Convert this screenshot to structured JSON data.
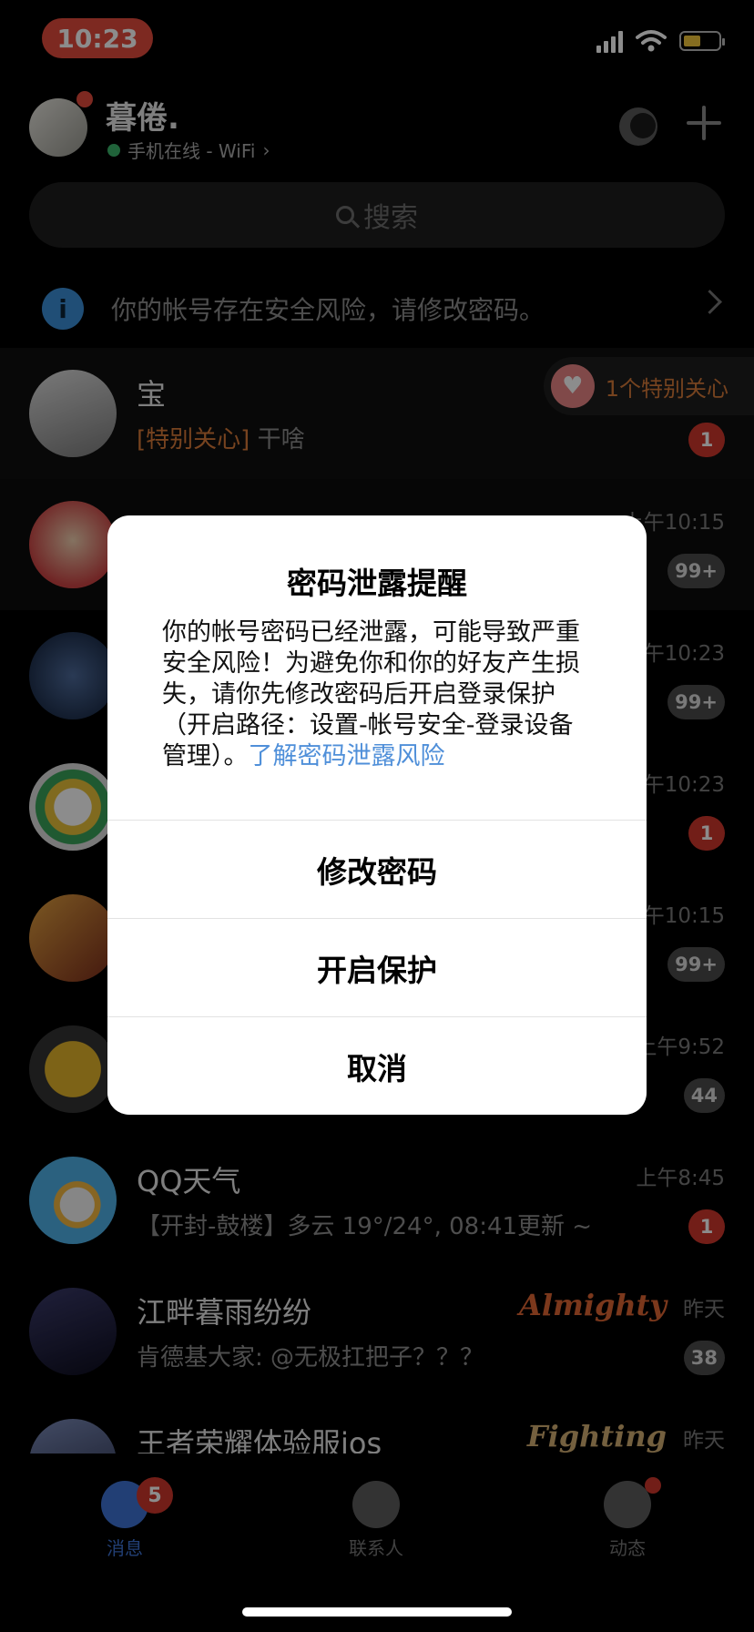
{
  "status_bar": {
    "time": "10:23"
  },
  "header": {
    "username": "暮倦.",
    "online_status": "手机在线 - WiFi",
    "online_chevron": "›"
  },
  "search": {
    "placeholder": "搜索"
  },
  "banner": {
    "icon_text": "i",
    "text": "你的帐号存在安全风险，请修改密码。"
  },
  "special_care_pill": {
    "label": "1个特别关心"
  },
  "chats": [
    {
      "name": "宝",
      "tag": "[特别关心]",
      "message": "干啥",
      "time": "",
      "badge": "1"
    },
    {
      "name": "",
      "message": "",
      "time": "上午10:15",
      "badge": "99+"
    },
    {
      "name": "",
      "message": "",
      "time": "上午10:23",
      "badge": "99+"
    },
    {
      "name": "",
      "message": "",
      "time": "上午10:23",
      "badge": "1"
    },
    {
      "name": "",
      "message": "",
      "time": "上午10:15",
      "badge": "99+"
    },
    {
      "name": "",
      "message": "",
      "time": "上午9:52",
      "badge": "44"
    },
    {
      "name": "QQ天气",
      "message": "【开封-鼓楼】多云 19°/24°, 08:41更新 ~",
      "time": "上午8:45",
      "badge": "1"
    },
    {
      "name": "江畔暮雨纷纷",
      "message": "肯德基大家: @无极扛把子？？？",
      "time": "昨天",
      "badge": "38",
      "logo": "Almighty"
    },
    {
      "name": "王者荣耀体验服ios",
      "message": "",
      "time": "昨天",
      "badge": "",
      "logo": "Fighting"
    }
  ],
  "dialog": {
    "title": "密码泄露提醒",
    "body": "你的帐号密码已经泄露，可能导致严重安全风险！为避免你和你的好友产生损失，请你先修改密码后开启登录保护（开启路径：设置-帐号安全-登录设备管理）。",
    "link": "了解密码泄露风险",
    "buttons": [
      "修改密码",
      "开启保护",
      "取消"
    ]
  },
  "tabbar": {
    "tabs": [
      {
        "label": "消息",
        "color": "#3e74d6"
      },
      {
        "label": "联系人",
        "color": "#777777"
      },
      {
        "label": "动态",
        "color": "#777777"
      }
    ],
    "messages_badge": "5"
  },
  "colors": {
    "accent_red": "#d0382c",
    "link_blue": "#4f8fd9",
    "special_orange": "#d97b3a"
  }
}
